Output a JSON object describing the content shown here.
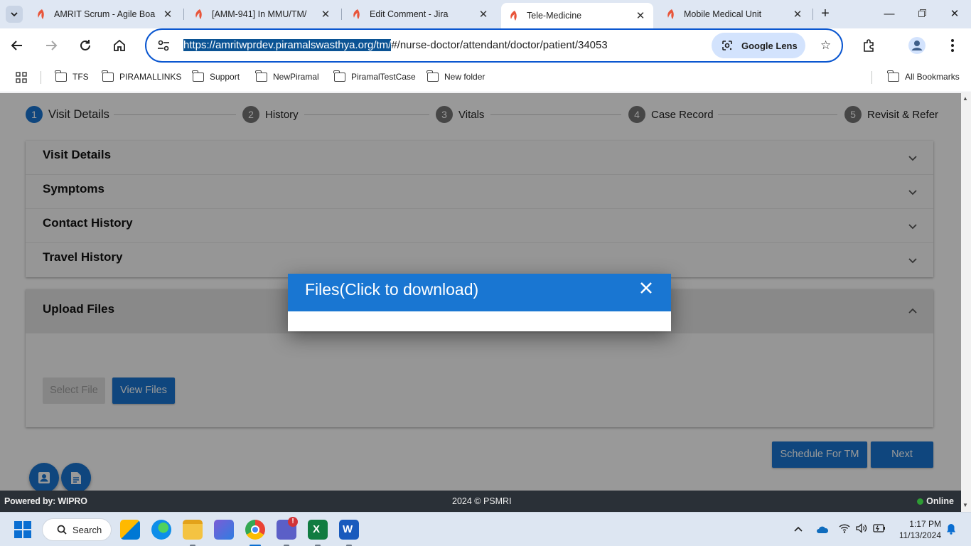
{
  "browser": {
    "tabs": [
      {
        "title": "AMRIT Scrum - Agile Boa",
        "active": false
      },
      {
        "title": "[AMM-941] In MMU/TM/",
        "active": false
      },
      {
        "title": "Edit Comment - Jira",
        "active": false
      },
      {
        "title": "Tele-Medicine",
        "active": true
      },
      {
        "title": "Mobile Medical Unit",
        "active": false
      }
    ],
    "url_selected": "https://amritwprdev.piramalswasthya.org/tm/",
    "url_rest": "#/nurse-doctor/attendant/doctor/patient/34053",
    "lens_label": "Google Lens",
    "bookmarks": [
      "TFS",
      "PIRAMALLINKS",
      "Support",
      "NewPiramal",
      "PiramalTestCase",
      "New folder"
    ],
    "all_bookmarks": "All Bookmarks"
  },
  "stepper": {
    "steps": [
      {
        "num": "1",
        "label": "Visit Details",
        "active": true
      },
      {
        "num": "2",
        "label": "History",
        "active": false
      },
      {
        "num": "3",
        "label": "Vitals",
        "active": false
      },
      {
        "num": "4",
        "label": "Case Record",
        "active": false
      },
      {
        "num": "5",
        "label": "Revisit & Refer",
        "active": false
      }
    ]
  },
  "panels": [
    "Visit Details",
    "Symptoms",
    "Contact History",
    "Travel History"
  ],
  "upload": {
    "title": "Upload Files",
    "select_file": "Select File",
    "view_files": "View Files"
  },
  "actions": {
    "schedule": "Schedule For TM",
    "next": "Next"
  },
  "modal": {
    "title": "Files(Click to download)"
  },
  "footer": {
    "powered": "Powered by: WIPRO",
    "copyright": "2024 © PSMRI",
    "status": "Online"
  },
  "taskbar": {
    "search": "Search",
    "time": "1:17 PM",
    "date": "11/13/2024"
  },
  "colors": {
    "primary": "#1976d2",
    "footer_bg": "#2a3037",
    "online": "#2e9c34"
  }
}
